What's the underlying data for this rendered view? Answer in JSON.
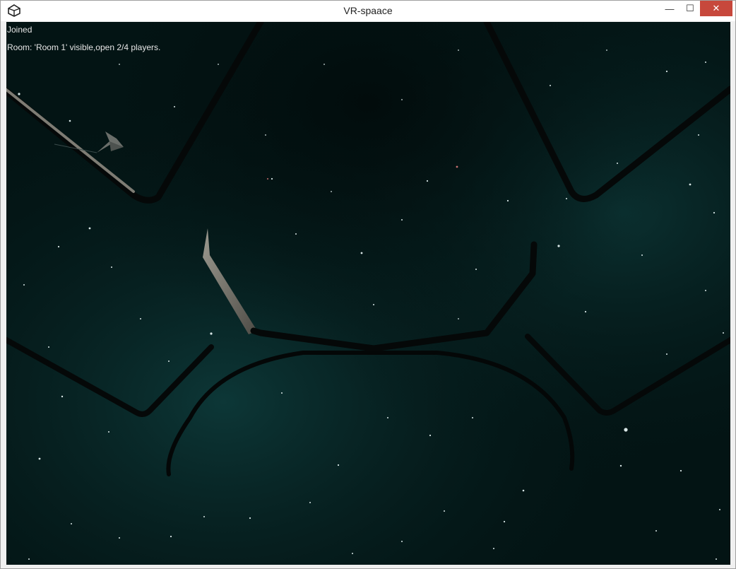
{
  "window": {
    "title": "VR-spaace",
    "app_icon": "unity-icon",
    "controls": {
      "minimize_glyph": "—",
      "maximize_glyph": "☐",
      "close_glyph": "✕"
    }
  },
  "hud": {
    "status": "Joined",
    "room_info": "Room: 'Room 1' visible,open 2/4 players."
  },
  "colors": {
    "space_background": "#031414",
    "nebula": "#0c3a3a",
    "hud_text": "#e6e6e6",
    "close_button": "#c7483c"
  }
}
